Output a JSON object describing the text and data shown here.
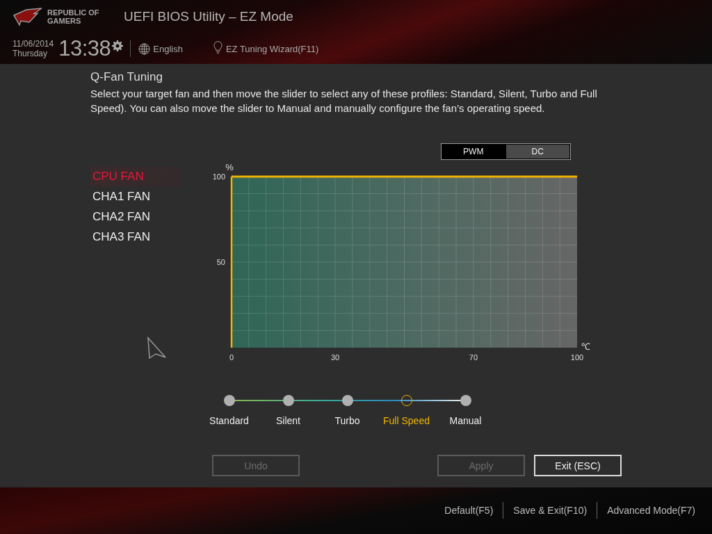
{
  "header": {
    "logo_lines": [
      "REPUBLIC OF",
      "GAMERS"
    ],
    "title": "UEFI BIOS Utility – EZ Mode",
    "date": "11/06/2014",
    "day": "Thursday",
    "time": "13:38",
    "language": "English",
    "wizard": "EZ Tuning Wizard(F11)"
  },
  "panel": {
    "title": "Q-Fan Tuning",
    "description": "Select your target fan and then move the slider to select any of these profiles: Standard, Silent, Turbo and Full Speed). You can also move the slider to Manual and manually configure the fan’s operating speed."
  },
  "fans": [
    {
      "label": "CPU FAN",
      "selected": true
    },
    {
      "label": "CHA1 FAN",
      "selected": false
    },
    {
      "label": "CHA2 FAN",
      "selected": false
    },
    {
      "label": "CHA3 FAN",
      "selected": false
    }
  ],
  "mode_toggle": [
    {
      "label": "PWM",
      "selected": true
    },
    {
      "label": "DC",
      "selected": false
    }
  ],
  "chart_data": {
    "type": "line",
    "xlabel": "℃",
    "ylabel": "%",
    "x": [
      0,
      100
    ],
    "series": [
      {
        "color": "#f0b400",
        "values": [
          100,
          100
        ]
      }
    ],
    "grid": true,
    "ref_lines": [
      {
        "axis": "x",
        "value": 0,
        "color": "#f0b400"
      }
    ],
    "xlim": [
      0,
      100
    ],
    "ylim": [
      0,
      100
    ],
    "xticks": [
      0,
      30,
      70,
      100
    ],
    "yticks": [
      50,
      100
    ]
  },
  "profiles": [
    {
      "label": "Standard",
      "selected": false
    },
    {
      "label": "Silent",
      "selected": false
    },
    {
      "label": "Turbo",
      "selected": false
    },
    {
      "label": "Full Speed",
      "selected": true
    },
    {
      "label": "Manual",
      "selected": false
    }
  ],
  "buttons": [
    {
      "label": "Undo",
      "disabled": true
    },
    {
      "label": "Apply",
      "disabled": true
    },
    {
      "label": "Exit (ESC)",
      "disabled": false
    }
  ],
  "footer": [
    "Default(F5)",
    "Save & Exit(F10)",
    "Advanced Mode(F7)"
  ]
}
